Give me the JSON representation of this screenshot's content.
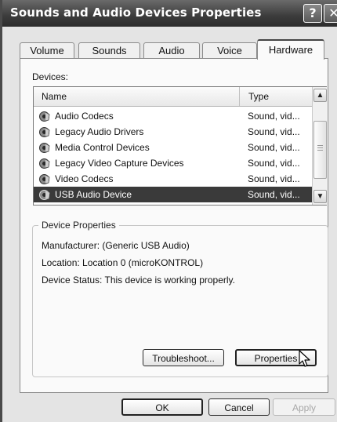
{
  "window": {
    "title": "Sounds and Audio Devices Properties",
    "help_glyph": "?",
    "close_glyph": "✕"
  },
  "tabs": [
    {
      "label": "Volume",
      "active": false
    },
    {
      "label": "Sounds",
      "active": false
    },
    {
      "label": "Audio",
      "active": false
    },
    {
      "label": "Voice",
      "active": false
    },
    {
      "label": "Hardware",
      "active": true
    }
  ],
  "devices": {
    "label": "Devices:",
    "columns": [
      "Name",
      "Type"
    ],
    "rows": [
      {
        "name": "Audio Codecs",
        "type": "Sound, vid...",
        "icon": "speaker-icon",
        "selected": false
      },
      {
        "name": "Legacy Audio Drivers",
        "type": "Sound, vid...",
        "icon": "speaker-icon",
        "selected": false
      },
      {
        "name": "Media Control Devices",
        "type": "Sound, vid...",
        "icon": "speaker-icon",
        "selected": false
      },
      {
        "name": "Legacy Video Capture Devices",
        "type": "Sound, vid...",
        "icon": "speaker-icon",
        "selected": false
      },
      {
        "name": "Video Codecs",
        "type": "Sound, vid...",
        "icon": "speaker-icon",
        "selected": false
      },
      {
        "name": "USB Audio Device",
        "type": "Sound, vid...",
        "icon": "speaker-icon",
        "selected": true
      }
    ]
  },
  "device_properties": {
    "title": "Device Properties",
    "manufacturer": "Manufacturer: (Generic USB Audio)",
    "location": "Location: Location 0 (microKONTROL)",
    "status": "Device Status: This device is working properly."
  },
  "buttons": {
    "troubleshoot": "Troubleshoot...",
    "properties": "Properties",
    "ok": "OK",
    "cancel": "Cancel",
    "apply": "Apply"
  }
}
